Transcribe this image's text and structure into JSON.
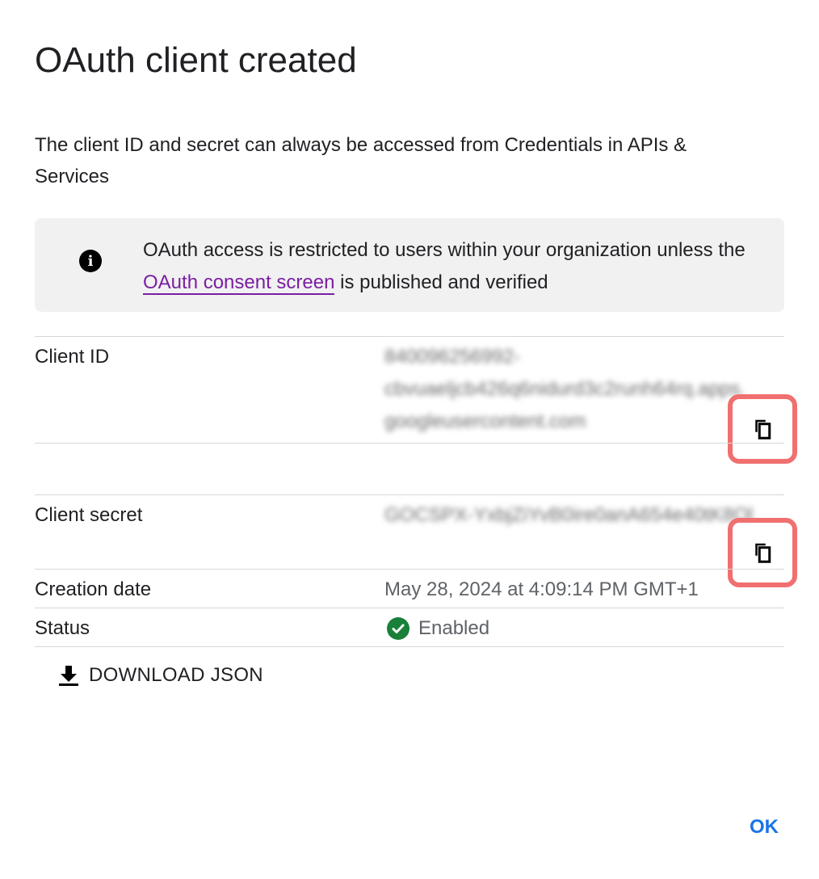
{
  "dialog": {
    "title": "OAuth client created",
    "description": "The client ID and secret can always be accessed from Credentials in APIs & Services"
  },
  "notice": {
    "icon": "info-icon",
    "text_before": "OAuth access is restricted to users within your organization unless the ",
    "link_text": "OAuth consent screen",
    "text_after": " is published and verified"
  },
  "fields": {
    "client_id_label": "Client ID",
    "client_id_value": [
      "840096256992-",
      "cbvuaeljcb426q6nidurd3c2runh64rq.apps.",
      "googleusercontent.com"
    ],
    "client_secret_label": "Client secret",
    "client_secret_value": "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",
    "creation_date_label": "Creation date",
    "creation_date_value": "May 28, 2024 at 4:09:14 PM GMT+1",
    "status_label": "Status",
    "status_value": "Enabled"
  },
  "actions": {
    "download_label": "DOWNLOAD JSON",
    "ok_label": "OK"
  },
  "colors": {
    "link": "#7a1fa2",
    "primary": "#1a73e8",
    "status_ok": "#188038",
    "highlight": "#f07070"
  }
}
